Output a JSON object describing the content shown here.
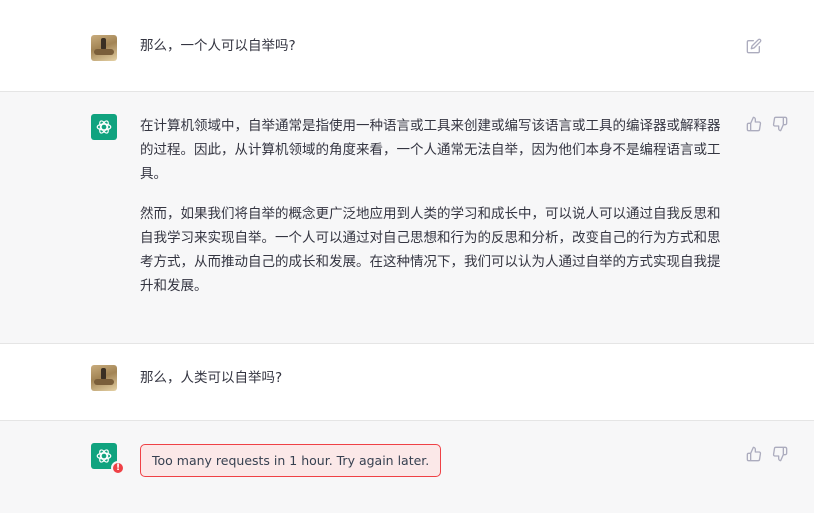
{
  "conversation": {
    "messages": [
      {
        "role": "user",
        "text": "那么，一个人可以自举吗?"
      },
      {
        "role": "assistant",
        "paragraphs": [
          "在计算机领域中，自举通常是指使用一种语言或工具来创建或编写该语言或工具的编译器或解释器的过程。因此，从计算机领域的角度来看，一个人通常无法自举，因为他们本身不是编程语言或工具。",
          "然而，如果我们将自举的概念更广泛地应用到人类的学习和成长中，可以说人可以通过自我反思和自我学习来实现自举。一个人可以通过对自己思想和行为的反思和分析，改变自己的行为方式和思考方式，从而推动自己的成长和发展。在这种情况下，我们可以认为人通过自举的方式实现自我提升和发展。"
        ]
      },
      {
        "role": "user",
        "text": "那么，人类可以自举吗?"
      },
      {
        "role": "assistant",
        "error": "Too many requests in 1 hour. Try again later."
      }
    ]
  },
  "icons": {
    "edit": "edit-icon",
    "thumbs_up": "thumbs-up-icon",
    "thumbs_down": "thumbs-down-icon",
    "assistant_logo": "openai-logo-icon",
    "error_badge": "!"
  },
  "colors": {
    "assistant_bg": "#f7f7f8",
    "brand_green": "#10a37f",
    "error_red": "#ef4146",
    "icon_gray": "#acacbe"
  }
}
